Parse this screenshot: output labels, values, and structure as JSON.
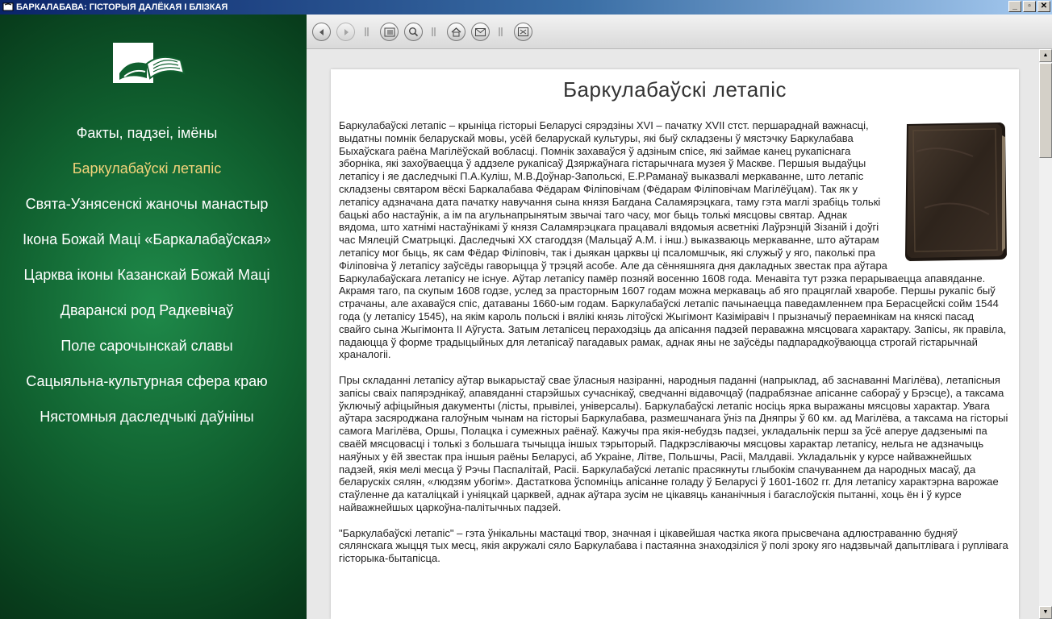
{
  "window": {
    "title": "БАРКАЛАБАВА: ГІСТОРЫЯ ДАЛЁКАЯ І БЛІЗКАЯ",
    "buttons": [
      "_",
      "▫",
      "✕"
    ]
  },
  "sidebar": {
    "logo_icon": "open-book-icon",
    "items": [
      {
        "label": "Факты, падзеі, імёны",
        "active": false
      },
      {
        "label": "Баркулабаўскі летапіс",
        "active": true
      },
      {
        "label": "Свята-Узнясенскі жаночы манастыр",
        "active": false
      },
      {
        "label": "Ікона Божай Маці «Баркалабаўская»",
        "active": false
      },
      {
        "label": "Царква іконы Казанскай Божай Маці",
        "active": false
      },
      {
        "label": "Дваранскі род Радкевічаў",
        "active": false
      },
      {
        "label": "Поле сарочынскай славы",
        "active": false
      },
      {
        "label": "Сацыяльна-культурная сфера краю",
        "active": false
      },
      {
        "label": "Нястомныя даследчыкі даўніны",
        "active": false
      }
    ],
    "active_color": "#f2d37a"
  },
  "toolbar": {
    "icons": [
      "back-icon",
      "forward-icon",
      "contents-icon",
      "search-icon",
      "home-icon",
      "mail-icon",
      "exit-icon"
    ]
  },
  "article": {
    "title": "Баркулабаўскі летапіс",
    "paragraphs": [
      "Баркулабаўскі летапіс – крыніца гісторыі Беларусі сярэдзіны XVI – пачатку XVII стст. першараднай важнасці, выдатны помнік беларускай мовы, усёй беларускай культуры, які быў складзены ў мястэчку Баркулабава Быхаўскага раёна Магілёўскай вобласці. Помнік захаваўся ў адзіным спісе, які займае канец рукапіснага зборніка, які захоўваецца ў аддзеле рукапісаў Дзяржаўнага гістарычнага музея ў Маскве. Першыя выдаўцы летапісу і яе даследчыкі П.А.Куліш, М.В.Доўнар-Запольскі, Е.Р.Раманаў выказвалі меркаванне, што летапіс складзены святаром вёскі Баркалабава Фёдарам Філіповічам (Фёдарам Філіповічам Магілёўцам). Так як у летапісу адзначана дата пачатку навучання сына князя Багдана Саламярэцкага, таму гэта маглі зрабіць толькі бацькі або настаўнік, а ім па агульнапрынятым звычаі таго часу, мог быць толькі мясцовы святар. Аднак вядома, што хатнімі настаўнікамі ў князя Саламярэцкага працавалі вядомыя асветнікі Лаўрэнцій Зізаній і доўгі час Мялецій Сматрыцкі. Даследчыкі ХХ стагоддзя (Мальцаў А.М. і інш.) выказваюць меркаванне, што аўтарам летапісу мог быць, як сам Фёдар Філіповіч, так і дыякан царквы ці псаломшчык, які служыў у яго, паколькі пра Філіповіча ў летапісу заўсёды гаворыцца ў трэцяй асобе. Але да сённяшняга дня дакладных звестак пра аўтара Баркулабаўскага летапісу не існуе. Аўтар летапісу памёр позняй восенню 1608 года. Менавіта тут рэзка перарываецца апавяданне. Акрамя таго, па скупым 1608 годзе, услед за прасторным 1607 годам можна меркаваць аб яго працяглай хваробе. Першы рукапіс быў страчаны, але ахаваўся спіс, датаваны 1660-ым годам. Баркулабаўскі летапіс пачынаецца паведамленнем пра Берасцейскі сойм 1544 года (у летапісу 1545), на якім кароль польскі і вялікі князь літоўскі Жыгімонт Казімiравiч I прызначыў пераемнікам на княскі пасад свайго сына Жыгімонта II Аўгуста. Затым летапісец пераходзіць да апісання падзей пераважна мясцовага характару. Запісы, як правіла, падаюцца ў форме традыцыйных для летапісаў пагадавых рамак, аднак яны не заўсёды падпарадкоўваюцца строгай гістарычнай храналогіі.",
      "Пры складанні летапісу аўтар выкарыстаў свае ўласныя назіранні, народныя паданні (напрыклад, аб заснаванні Магілёва), летапісныя запісы сваіх папярэднікаў, апавяданні старэйшых сучаснікаў, сведчанні відавочцаў (падрабязнае апісанне сабораў у Брэсце), а таксама ўключыў афіцыйныя дакументы (лісты, прывілеі, універсалы). Баркулабаўскі летапіс носіць ярка выражаны мясцовы характар. Увага аўтара засяроджана галоўным чынам на гісторыі Баркулабава, размешчанага ўніз па Дняпры ў 60 км. ад Магілёва, а таксама на гісторыі самога Магілёва, Оршы, Полацка і сумежных раёнаў. Кажучы пра якія-небудзь падзеі, укладальнік перш за ўсё аперуе дадзенымі па сваёй мясцовасці і толькі з большага тычыцца іншых тэрыторый. Падкрэсліваючы мясцовы характар летапісу, нельга не адзначыць наяўных у ёй звестак пра іншыя раёны Беларусі, аб Украіне, Літве, Польшчы, Расіі, Малдавіі. Укладальнік у курсе найважнейшых падзей, якія мелі месца ў Рэчы Паспалітай, Расіі. Баркулабаўскі летапіс прасякнуты глыбокім спачуваннем да народных масаў, да беларускіх сялян, «людзям убогім». Дастаткова ўспомніць апісанне голаду ў Беларусі ў 1601-1602 гг. Для летапісу характэрна варожае стаўленне да каталіцкай і уніяцкай царквей, аднак аўтара зусім не цікавяць кананічныя і багаслоўскія пытанні, хоць ён і ў курсе найважнейшых царкоўна-палітычных падзей.",
      "\"Баркулабаўскі летапіс\" – гэта ўнікальны мастацкі твор, значная і цікавейшая частка якога прысвечана адлюстраванню будняў сялянскага жыцця тых месц, якія акружалі сяло Баркулабава і пастаянна знаходзіліся ў полі зроку яго надзвычай дапытлівага і руплівага гісторыка-бытапісца."
    ],
    "image_icon": "old-book-picture"
  },
  "scrollbar": {
    "up": "▲",
    "down": "▼"
  },
  "colors": {
    "sidebar_green": "#10602f",
    "active_item": "#f2d37a"
  }
}
